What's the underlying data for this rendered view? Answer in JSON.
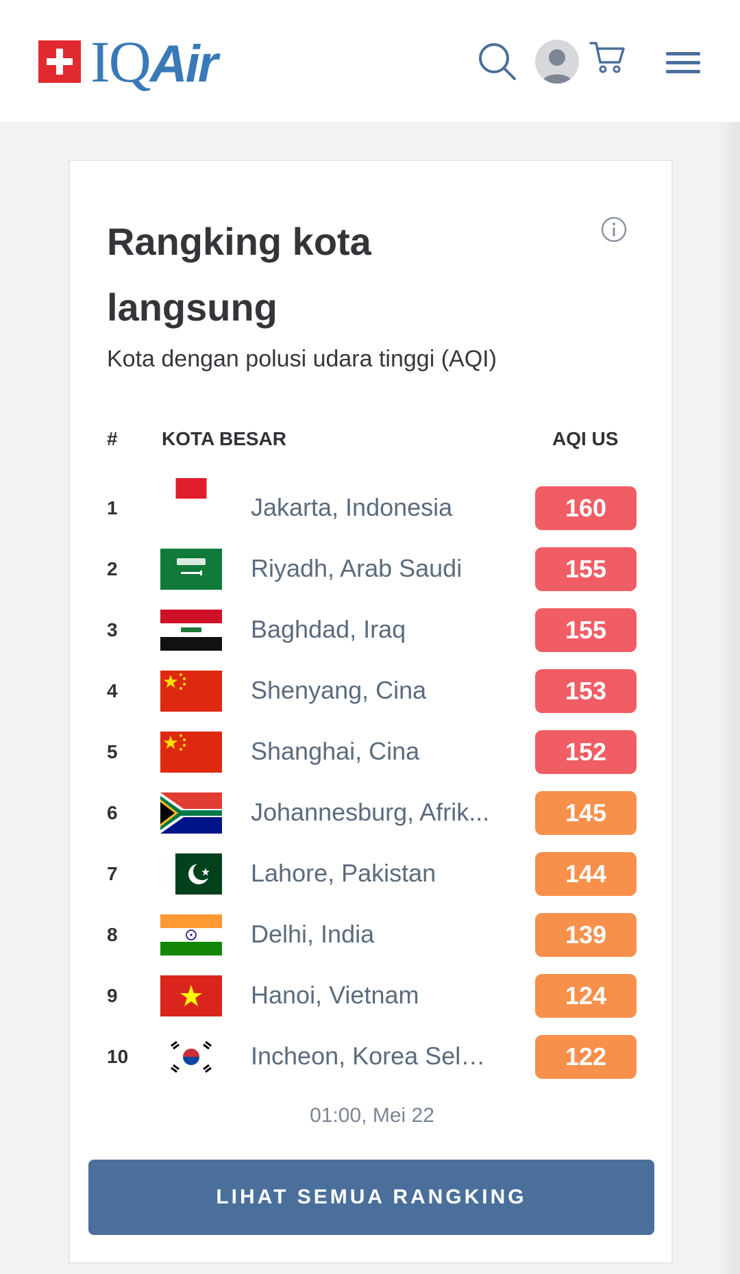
{
  "header": {
    "logo_text_iq": "IQ",
    "logo_text_air": "Air",
    "icons": [
      "swiss-flag-icon",
      "search-icon",
      "user-avatar-icon",
      "cart-icon",
      "hamburger-menu-icon"
    ]
  },
  "card": {
    "title": "Rangking kota langsung",
    "subtitle": "Kota dengan polusi udara tinggi (AQI)",
    "columns": {
      "rank": "#",
      "city": "KOTA BESAR",
      "aqi": "AQI US"
    },
    "rows": [
      {
        "rank": "1",
        "city": "Jakarta, Indonesia",
        "aqi": "160",
        "flag": "indonesia-flag"
      },
      {
        "rank": "2",
        "city": "Riyadh, Arab Saudi",
        "aqi": "155",
        "flag": "saudi-arabia-flag"
      },
      {
        "rank": "3",
        "city": "Baghdad, Iraq",
        "aqi": "155",
        "flag": "iraq-flag"
      },
      {
        "rank": "4",
        "city": "Shenyang, Cina",
        "aqi": "153",
        "flag": "china-flag"
      },
      {
        "rank": "5",
        "city": "Shanghai, Cina",
        "aqi": "152",
        "flag": "china-flag"
      },
      {
        "rank": "6",
        "city": "Johannesburg, Afrik...",
        "aqi": "145",
        "flag": "south-africa-flag"
      },
      {
        "rank": "7",
        "city": "Lahore, Pakistan",
        "aqi": "144",
        "flag": "pakistan-flag"
      },
      {
        "rank": "8",
        "city": "Delhi, India",
        "aqi": "139",
        "flag": "india-flag"
      },
      {
        "rank": "9",
        "city": "Hanoi, Vietnam",
        "aqi": "124",
        "flag": "vietnam-flag"
      },
      {
        "rank": "10",
        "city": "Incheon, Korea Selat...",
        "aqi": "122",
        "flag": "south-korea-flag"
      }
    ],
    "timestamp": "01:00, Mei 22",
    "cta_label": "LIHAT SEMUA RANGKING"
  },
  "colors": {
    "unhealthy": "#f05d64",
    "sensitive": "#f7904a",
    "brand": "#3a79b8",
    "cta": "#4a6f9b"
  }
}
